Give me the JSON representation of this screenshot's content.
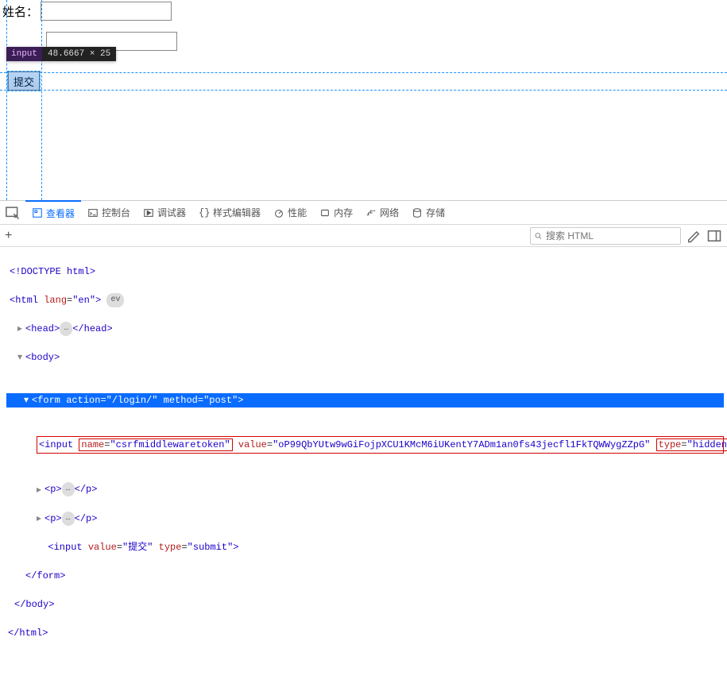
{
  "page": {
    "name_label": "姓名：",
    "submit_label": "提交"
  },
  "dim_tip": {
    "tag": "input",
    "size": "48.6667 × 25"
  },
  "devtools": {
    "tabs": {
      "inspector": "查看器",
      "console": "控制台",
      "debugger": "调试器",
      "style": "样式编辑器",
      "perf": "性能",
      "memory": "内存",
      "network": "网络",
      "storage": "存储"
    },
    "search_placeholder": "搜索 HTML"
  },
  "tree": {
    "doctype": "<!DOCTYPE html>",
    "html_open": "html",
    "html_lang_attr": "lang",
    "html_lang_val": "\"en\"",
    "head": "head",
    "body": "body",
    "form_tag": "form",
    "form_action_attr": "action",
    "form_action_val": "\"/login/\"",
    "form_method_attr": "method",
    "form_method_val": "\"post\"",
    "csrf_tag_open": "<input",
    "csrf_name_frag": "name=\"csrfmiddlewaretoken\"",
    "csrf_value_frag": "value=\"oP99QbYUtw9wGiFojpXCU1KMcM6iUKentY7ADm1an0fs43jecfl1FkTQWWygZZpG\"",
    "csrf_type_frag": "type=\"hidden\">",
    "p": "p",
    "submit_tag": "input",
    "submit_value_attr": "value",
    "submit_value_val": "\"提交\"",
    "submit_type_attr": "type",
    "submit_type_val": "\"submit\"",
    "close_form": "</form>",
    "close_body": "</body>",
    "close_html": "</html>"
  }
}
